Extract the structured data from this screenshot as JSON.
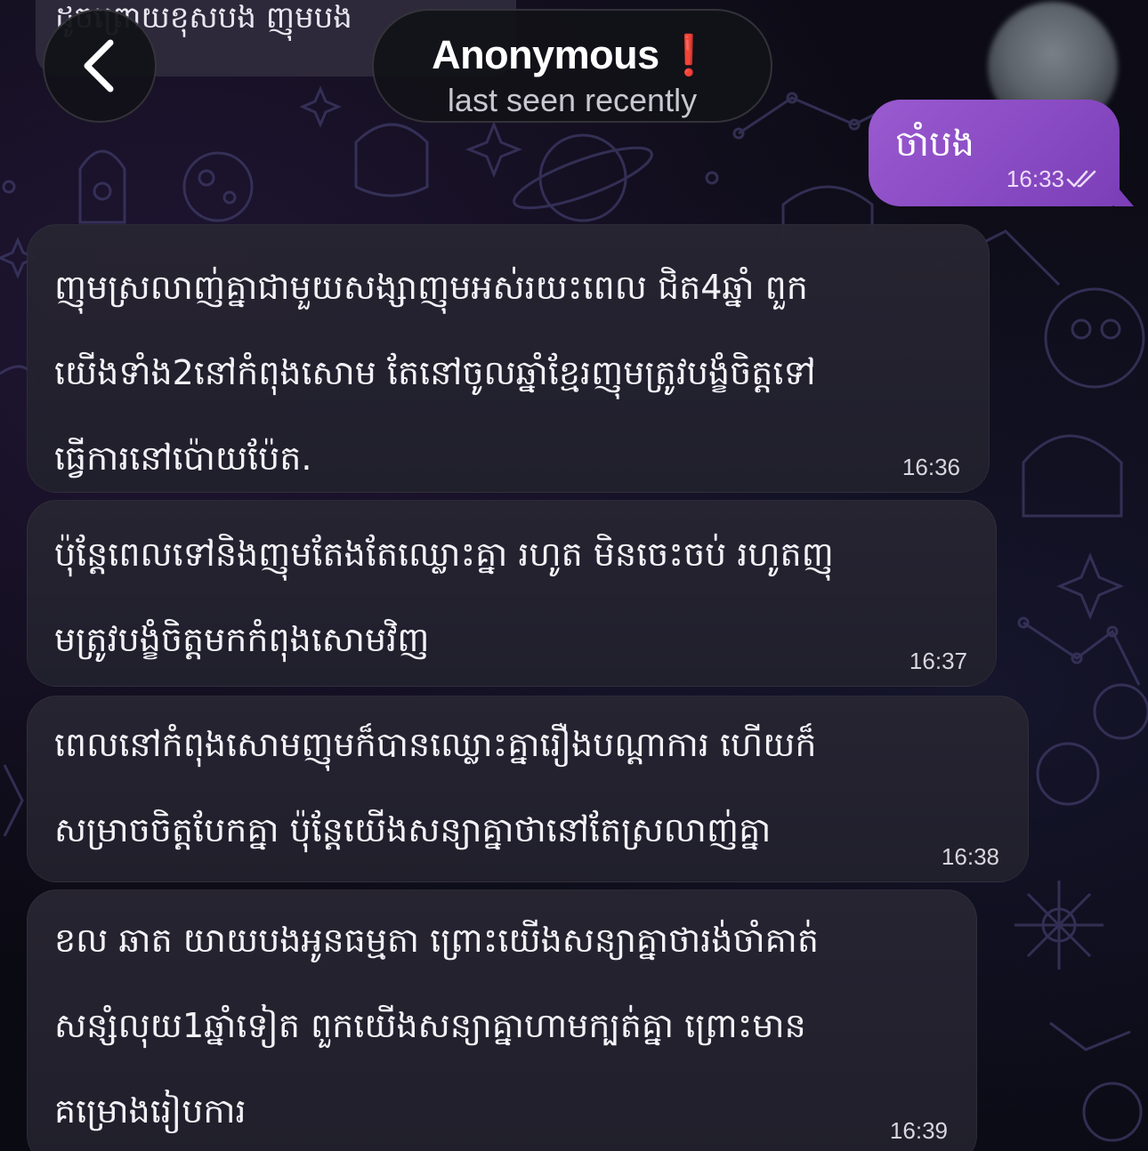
{
  "header": {
    "partial_message": "ដូចព្រោយខុសបង ញុមបង",
    "contact_name": "Anonymous",
    "contact_flag": "❗",
    "contact_status": "last seen recently"
  },
  "outgoing": {
    "text": "ចាំបង",
    "time": "16:33",
    "status": "read"
  },
  "incoming": [
    {
      "lines": [
        "ញុមស្រលាញ់គ្នាជាមួយសង្សាញុមអស់រយះពេល ជិត4ឆ្នាំ ពួក",
        "យើងទាំង2នៅកំពុងសោម តែនៅចូលឆ្នាំខ្មែរញុមត្រូវបង្ខំចិត្តទៅ",
        "ធ្វើការនៅប៉ោយប៉ែត."
      ],
      "time": "16:36"
    },
    {
      "lines": [
        "ប៉ុន្តែពេលទៅនិងញុមតែងតែឈ្លោះគ្នា រហូត មិនចេះចប់ រហូតញុ",
        "មត្រូវបង្ខំចិត្តមកកំពុងសោមវិញ"
      ],
      "time": "16:37"
    },
    {
      "lines": [
        "ពេលនៅកំពុងសោមញុមក៏បានឈ្លោះគ្នារឿងបណ្តាការ ហើយក៏",
        "សម្រាចចិត្តបែកគ្នា ប៉ុន្តែយើងសន្យាគ្នាថានៅតែស្រលាញ់គ្នា"
      ],
      "time": "16:38"
    },
    {
      "lines": [
        "ខល ឆាត យាយបងអូនធម្មតា ព្រោះយើងសន្យាគ្នាថារង់ចាំគាត់",
        "សន្សំលុយ1ឆ្នាំទៀត ពួកយើងសន្យាគ្នាហាមក្បត់គ្នា ព្រោះមាន",
        "គម្រោងរៀបការ"
      ],
      "time": "16:39"
    }
  ],
  "icons": {
    "back": "chevron-left-icon",
    "read_receipt": "double-check-icon"
  },
  "colors": {
    "outgoing_bubble": "#8b4cc6",
    "incoming_bubble": "#262433",
    "alert": "#e8232b",
    "background": "#0c0c14"
  }
}
